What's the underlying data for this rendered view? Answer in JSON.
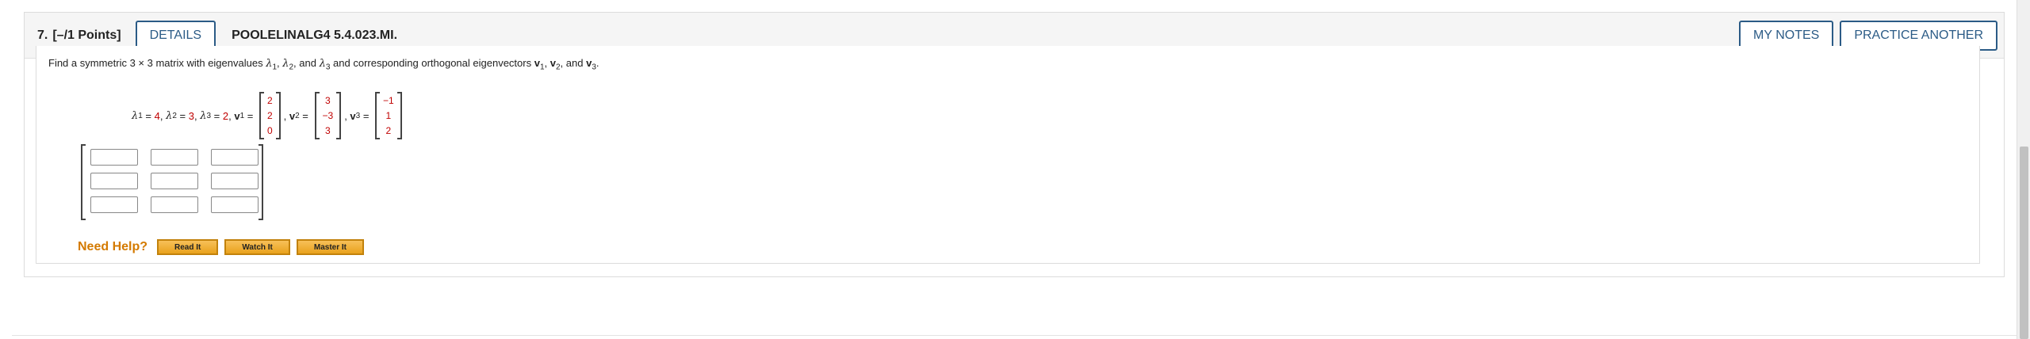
{
  "header": {
    "question_number": "7.",
    "points": "[–/1 Points]",
    "details_label": "DETAILS",
    "question_code": "POOLELINALG4 5.4.023.MI.",
    "my_notes_label": "MY NOTES",
    "practice_another_label": "PRACTICE ANOTHER"
  },
  "prompt": {
    "part1": "Find a symmetric 3 × 3 matrix with eigenvalues ",
    "lambda": "λ",
    "sub1": "1",
    "sub2": "2",
    "sub3": "3",
    "comma": ", ",
    "and": "and",
    "part2": " and corresponding orthogonal eigenvectors ",
    "v": "v",
    "period": "."
  },
  "equation": {
    "lambda1_value": "4",
    "lambda2_value": "3",
    "lambda3_value": "2",
    "equals": " = ",
    "v1": [
      "2",
      "2",
      "0"
    ],
    "v2": [
      "3",
      "−3",
      "3"
    ],
    "v3": [
      "−1",
      "1",
      "2"
    ]
  },
  "answer_matrix": {
    "cells": [
      "",
      "",
      "",
      "",
      "",
      "",
      "",
      "",
      ""
    ]
  },
  "help": {
    "label": "Need Help?",
    "read_it": "Read It",
    "watch_it": "Watch It",
    "master_it": "Master It"
  },
  "colors": {
    "accent": "#2b5b86",
    "value_red": "#c00000",
    "help_orange": "#d47a00",
    "help_button": "#f0b030"
  }
}
